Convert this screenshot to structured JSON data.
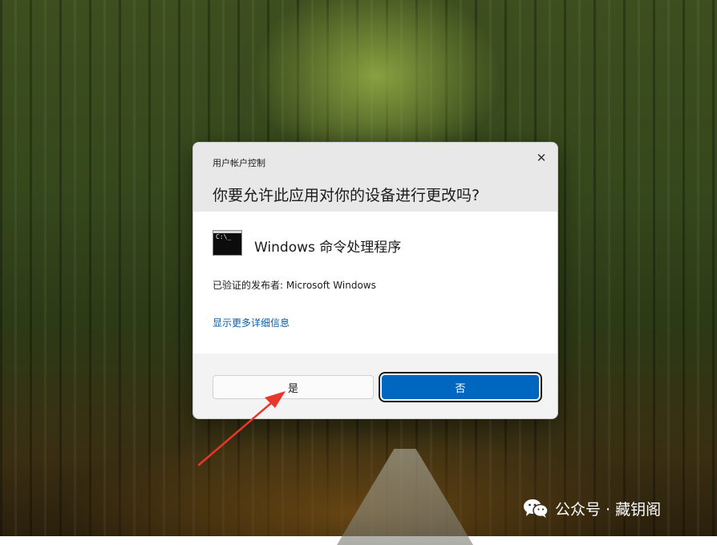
{
  "dialog": {
    "window_title": "用户帐户控制",
    "close_glyph": "✕",
    "question": "你要允许此应用对你的设备进行更改吗?",
    "app": {
      "icon_name": "command-prompt-icon",
      "icon_text": "C:\\_",
      "name": "Windows 命令处理程序"
    },
    "publisher": "已验证的发布者: Microsoft Windows",
    "more_info_link": "显示更多详细信息",
    "yes_button": "是",
    "no_button": "否"
  },
  "annotation": {
    "arrow_color": "#e8372b",
    "target": "yes_button"
  },
  "watermark": {
    "icon_name": "wechat-icon",
    "text": "公众号 · 藏钥阁"
  },
  "colors": {
    "primary_button": "#0067c0",
    "link": "#0a5ea8"
  }
}
